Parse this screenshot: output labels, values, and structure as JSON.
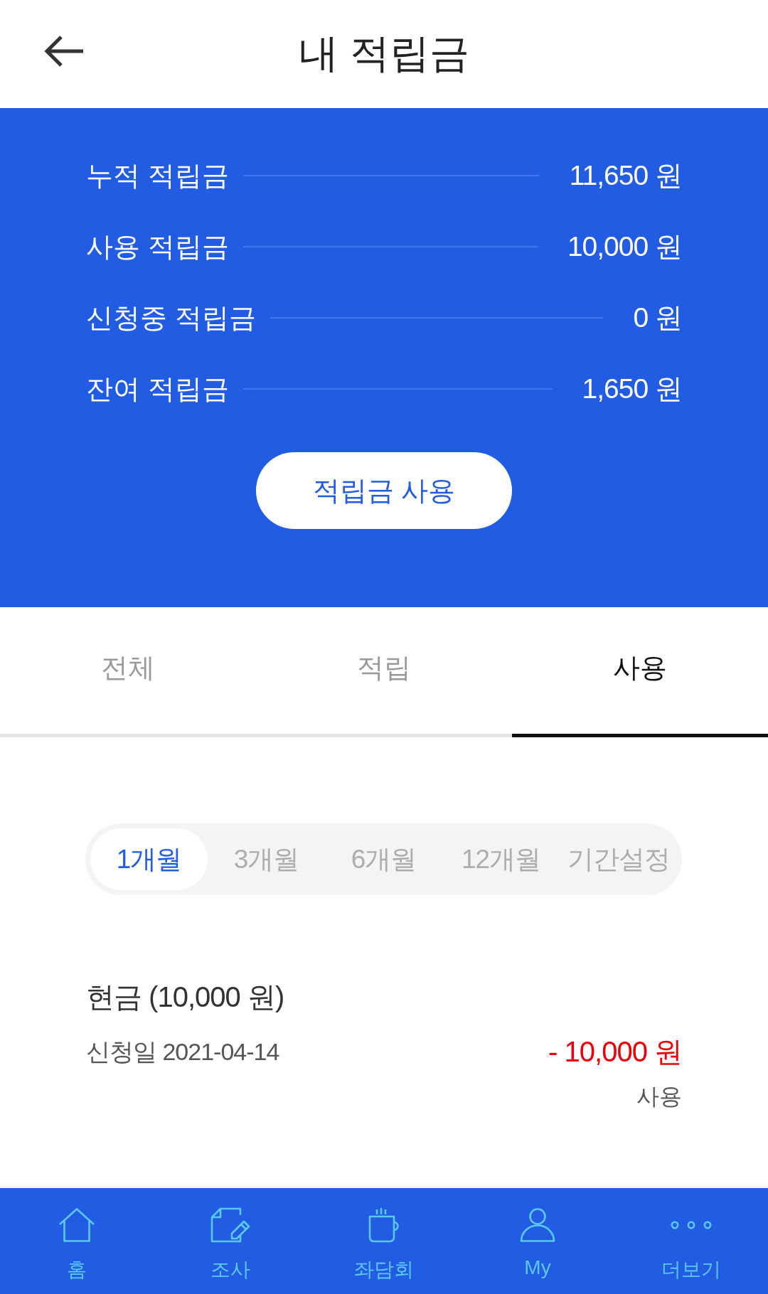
{
  "header": {
    "title": "내 적립금"
  },
  "summary": {
    "rows": [
      {
        "label": "누적 적립금",
        "value": "11,650 원"
      },
      {
        "label": "사용 적립금",
        "value": "10,000 원"
      },
      {
        "label": "신청중 적립금",
        "value": "0 원"
      },
      {
        "label": "잔여 적립금",
        "value": "1,650 원"
      }
    ],
    "button": "적립금 사용"
  },
  "tabs": [
    {
      "label": "전체",
      "selected": false
    },
    {
      "label": "적립",
      "selected": false
    },
    {
      "label": "사용",
      "selected": true
    }
  ],
  "periods": [
    {
      "label": "1개월",
      "selected": true
    },
    {
      "label": "3개월",
      "selected": false
    },
    {
      "label": "6개월",
      "selected": false
    },
    {
      "label": "12개월",
      "selected": false
    },
    {
      "label": "기간설정",
      "selected": false
    }
  ],
  "history": [
    {
      "title": "현금 (10,000 원)",
      "date": "신청일 2021-04-14",
      "amount": "- 10,000 원",
      "status": "사용"
    }
  ],
  "bottom_nav": [
    {
      "label": "홈"
    },
    {
      "label": "조사"
    },
    {
      "label": "좌담회"
    },
    {
      "label": "My"
    },
    {
      "label": "더보기"
    }
  ]
}
